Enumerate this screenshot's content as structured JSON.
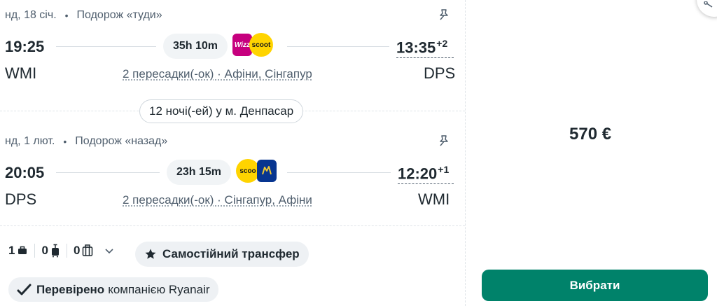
{
  "outbound": {
    "date": "нд, 18 січ.",
    "dot": "•",
    "label": "Подорож «туди»",
    "dep_time": "19:25",
    "duration": "35h 10m",
    "arr_time": "13:35",
    "arr_day_offset": "+2",
    "dep_airport": "WMI",
    "stops": "2 пересадки(-ок) · Афіни, Сінгапур",
    "arr_airport": "DPS",
    "carriers": [
      "Wizz Air",
      "Scoot"
    ],
    "wizz_logo_text": "Wizz",
    "scoot_logo_text": "scoot"
  },
  "nights": "12 ночі(-ей) у м. Денпасар",
  "inbound": {
    "date": "нд, 1 лют.",
    "dot": "•",
    "label": "Подорож «назад»",
    "dep_time": "20:05",
    "duration": "23h 15m",
    "arr_time": "12:20",
    "arr_day_offset": "+1",
    "dep_airport": "DPS",
    "stops": "2 пересадки(-ок) · Сінгапур, Афіни",
    "arr_airport": "WMI",
    "carriers": [
      "Scoot",
      "Ryanair"
    ],
    "scoot_logo_text": "scoo"
  },
  "bags": {
    "personal": "1",
    "cabin": "0",
    "checked": "0"
  },
  "transfer_label": "Самостійний трансфер",
  "verified": {
    "strong": "Перевірено",
    "rest": "компанією Ryanair"
  },
  "price": "570 €",
  "select_label": "Вибрати",
  "colors": {
    "accent": "#00826a",
    "text": "#1f2930",
    "muted": "#4f5e6d",
    "chip_bg": "#eef1f4"
  },
  "icons": [
    "pin-icon",
    "suitcase-icon",
    "cabin-bag-icon",
    "checked-bag-icon",
    "chevron-down-icon",
    "star-icon",
    "check-icon",
    "share-icon"
  ]
}
